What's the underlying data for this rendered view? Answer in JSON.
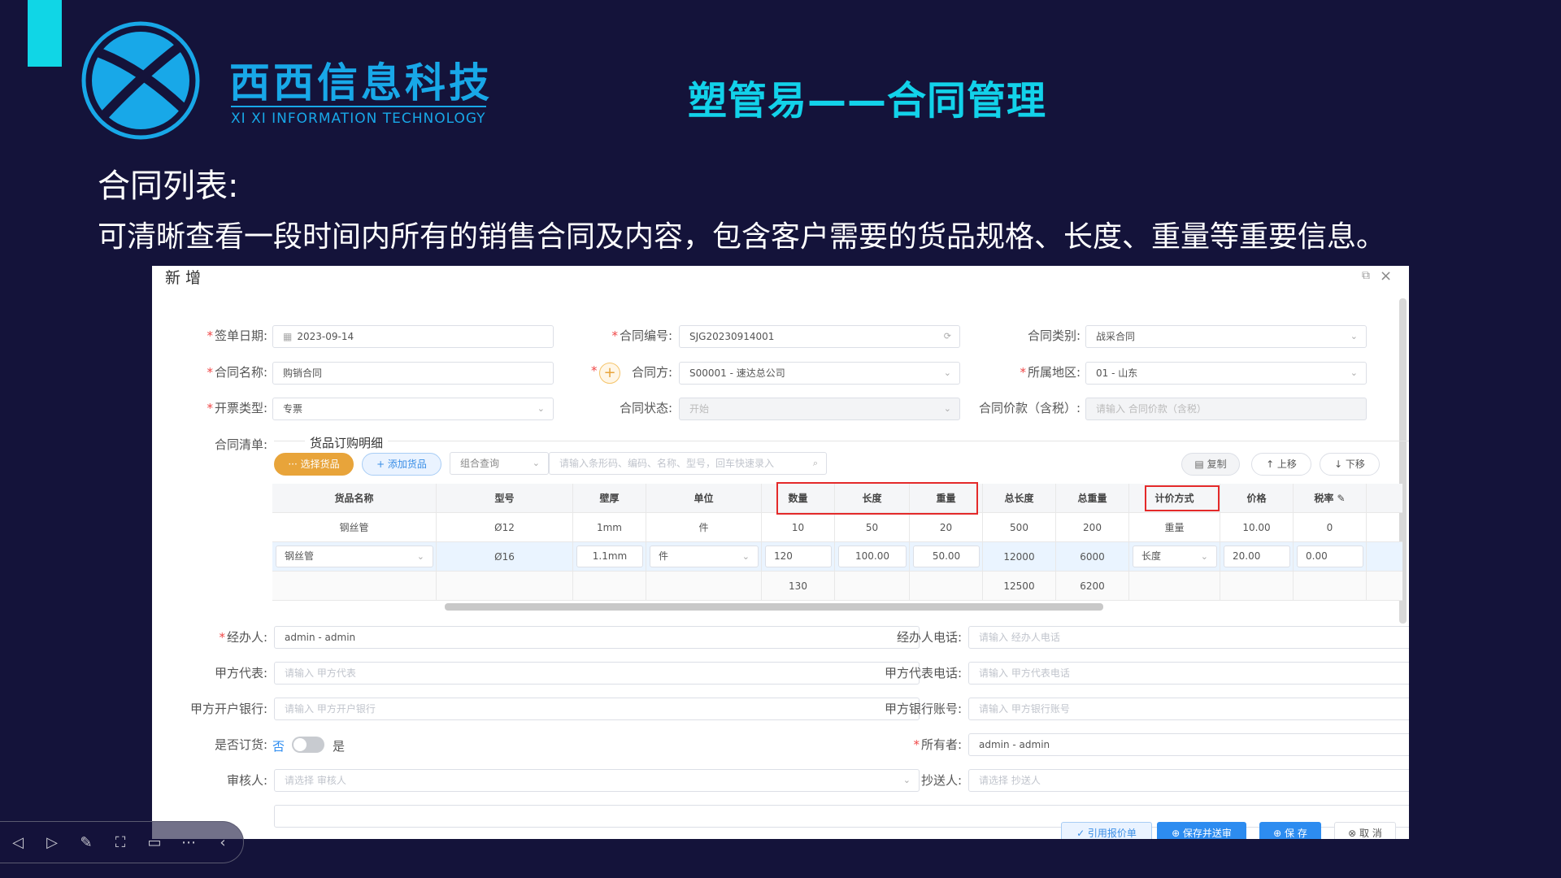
{
  "brand": {
    "name_cn": "西西信息科技",
    "name_en": "XI XI INFORMATION TECHNOLOGY"
  },
  "slide": {
    "title": "塑管易——合同管理",
    "section_heading": "合同列表:",
    "section_desc": "可清晰查看一段时间内所有的销售合同及内容，包含客户需要的货品规格、长度、重量等重要信息。"
  },
  "dialog": {
    "title": "新 增",
    "form": {
      "sign_date": {
        "label": "签单日期:",
        "value": "2023-09-14"
      },
      "contract_no": {
        "label": "合同编号:",
        "value": "SJG20230914001"
      },
      "contract_type": {
        "label": "合同类别:",
        "value": "战采合同"
      },
      "contract_name": {
        "label": "合同名称:",
        "value": "购销合同"
      },
      "party": {
        "label": "合同方:",
        "value": "S00001 - 速达总公司"
      },
      "region": {
        "label": "所属地区:",
        "value": "01 - 山东"
      },
      "invoice_type": {
        "label": "开票类型:",
        "value": "专票"
      },
      "status": {
        "label": "合同状态:",
        "value": "开始"
      },
      "price": {
        "label": "合同价款（含税）:",
        "placeholder": "请输入 合同价款（含税）"
      },
      "list_label": "合同清单:"
    },
    "detail_tab": "货品订购明细",
    "toolbar": {
      "select_goods": "··· 选择货品",
      "add_goods": "+ 添加货品",
      "combo_query": "组合查询",
      "search_placeholder": "请输入条形码、编码、名称、型号，回车快速录入",
      "copy": "复制",
      "move_up": "↑ 上移",
      "move_down": "↓ 下移"
    },
    "table": {
      "columns": [
        "货品名称",
        "型号",
        "壁厚",
        "单位",
        "数量",
        "长度",
        "重量",
        "总长度",
        "总重量",
        "计价方式",
        "价格",
        "税率 ✎"
      ],
      "rows": [
        [
          "钢丝管",
          "Ø12",
          "1mm",
          "件",
          "10",
          "50",
          "20",
          "500",
          "200",
          "重量",
          "10.00",
          "0"
        ],
        [
          "钢丝管",
          "Ø16",
          "1.1mm",
          "件",
          "120",
          "100.00",
          "50.00",
          "12000",
          "6000",
          "长度",
          "20.00",
          "0.00"
        ]
      ],
      "totals": {
        "qty": "130",
        "total_length": "12500",
        "total_weight": "6200"
      }
    },
    "form2": {
      "handler": {
        "label": "经办人:",
        "value": "admin - admin"
      },
      "handler_phone": {
        "label": "经办人电话:",
        "placeholder": "请输入 经办人电话"
      },
      "party_a_rep": {
        "label": "甲方代表:",
        "placeholder": "请输入 甲方代表"
      },
      "party_a_rep_phone": {
        "label": "甲方代表电话:",
        "placeholder": "请输入 甲方代表电话"
      },
      "party_a_bank": {
        "label": "甲方开户银行:",
        "placeholder": "请输入 甲方开户银行"
      },
      "party_a_account": {
        "label": "甲方银行账号:",
        "placeholder": "请输入 甲方银行账号"
      },
      "is_order": {
        "label": "是否订货:",
        "off": "否",
        "on": "是"
      },
      "owner": {
        "label": "所有者:",
        "value": "admin - admin"
      },
      "reviewer": {
        "label": "审核人:",
        "placeholder": "请选择 审核人"
      },
      "cc": {
        "label": "抄送人:",
        "placeholder": "请选择 抄送人"
      }
    },
    "footer": {
      "quote": "✓ 引用报价单",
      "save_submit": "⊕ 保存并送审",
      "save": "⊕ 保 存",
      "cancel": "⊗ 取 消"
    }
  },
  "colors": {
    "background": "#14133a",
    "accent": "#10d6e6",
    "brand": "#18a8e8",
    "highlight": "#e42a2a"
  }
}
